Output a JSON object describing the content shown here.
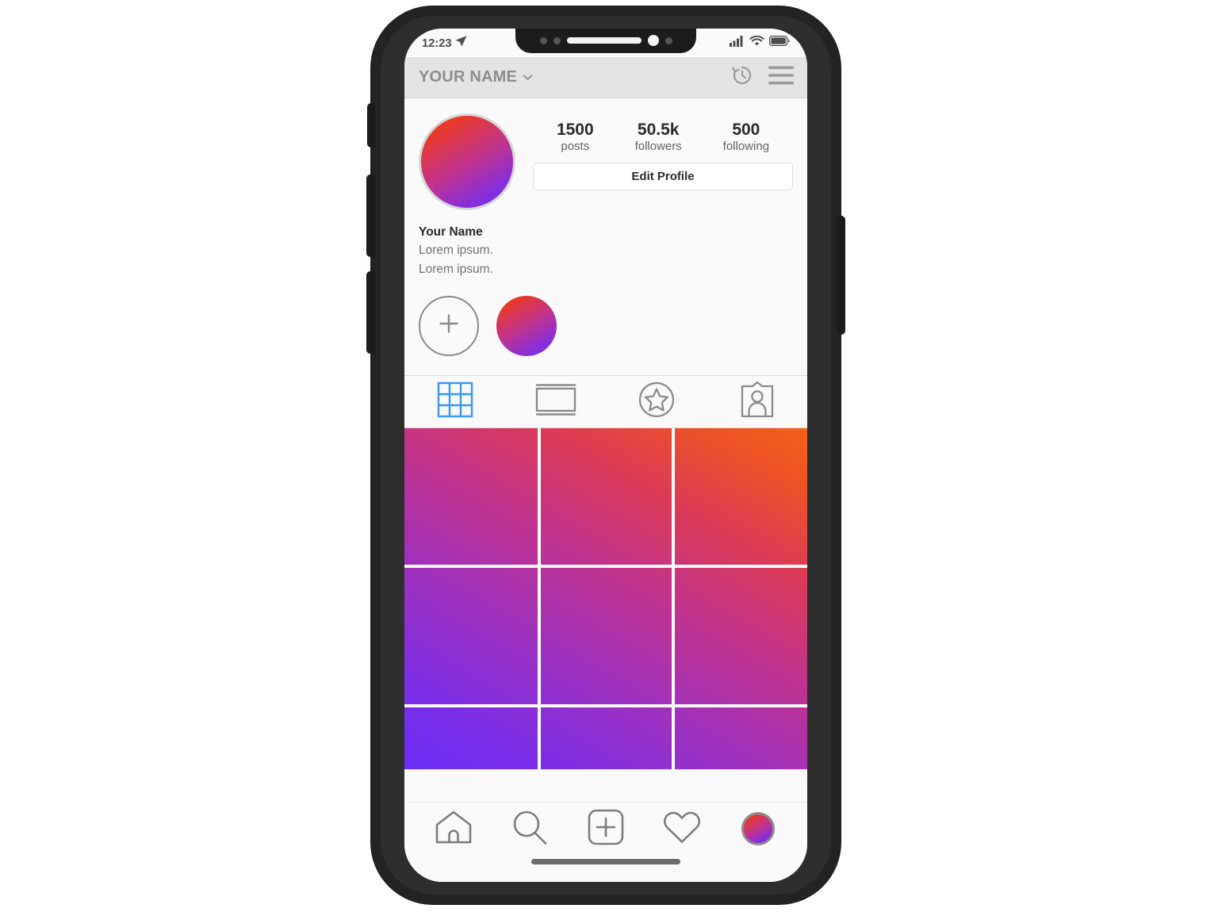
{
  "device": {
    "name": "smartphone-mockup",
    "frame_color": "#232323",
    "screen_bg": "#fafafa"
  },
  "status_bar": {
    "time": "12:23",
    "location_icon": "location-arrow-icon",
    "signal_icon": "cellular-signal-icon",
    "wifi_icon": "wifi-icon",
    "battery_icon": "battery-full-icon"
  },
  "profile_header": {
    "username": "YOUR NAME",
    "dropdown_icon": "chevron-down-icon",
    "archive_icon": "clock-history-icon",
    "menu_icon": "hamburger-menu-icon",
    "background": "#e4e4e4",
    "text_color": "#8d8d8d"
  },
  "profile": {
    "avatar_icon": "profile-avatar",
    "display_name": "Your Name",
    "bio_lines": [
      "Lorem ipsum.",
      "Lorem ipsum."
    ],
    "edit_profile_label": "Edit Profile",
    "stats": [
      {
        "value": "1500",
        "label": "posts"
      },
      {
        "value": "50.5k",
        "label": "followers"
      },
      {
        "value": "500",
        "label": "following"
      }
    ]
  },
  "highlights": {
    "new_highlight_icon": "plus-circle-icon",
    "items": [
      {
        "name": "story-highlight-circle"
      }
    ]
  },
  "tabs": [
    {
      "id": "grid",
      "icon": "grid-icon",
      "active": true,
      "active_color": "#3897f0"
    },
    {
      "id": "igtv",
      "icon": "igtv-tv-icon",
      "active": false
    },
    {
      "id": "guides",
      "icon": "star-circle-icon",
      "active": false
    },
    {
      "id": "tagged",
      "icon": "tagged-person-icon",
      "active": false
    }
  ],
  "photo_grid": {
    "columns": 3,
    "rows": 3,
    "gradient_from": "#6b2ef5",
    "gradient_to": "#f4601a",
    "gridline_color": "#fafafa"
  },
  "bottom_nav": [
    {
      "id": "home",
      "icon": "home-icon"
    },
    {
      "id": "search",
      "icon": "search-icon"
    },
    {
      "id": "add-post",
      "icon": "plus-square-icon"
    },
    {
      "id": "activity",
      "icon": "heart-icon"
    },
    {
      "id": "profile",
      "icon": "profile-avatar-small"
    }
  ],
  "home_indicator": {
    "name": "home-indicator-bar",
    "color": "#6d6d6d"
  },
  "colors": {
    "brand_gradient_orange": "#f4411f",
    "brand_gradient_pink": "#c0338f",
    "brand_gradient_purple": "#6b2ef5",
    "accent_blue": "#3897f0",
    "text_dark": "#2b2b2b",
    "text_muted": "#717171"
  }
}
